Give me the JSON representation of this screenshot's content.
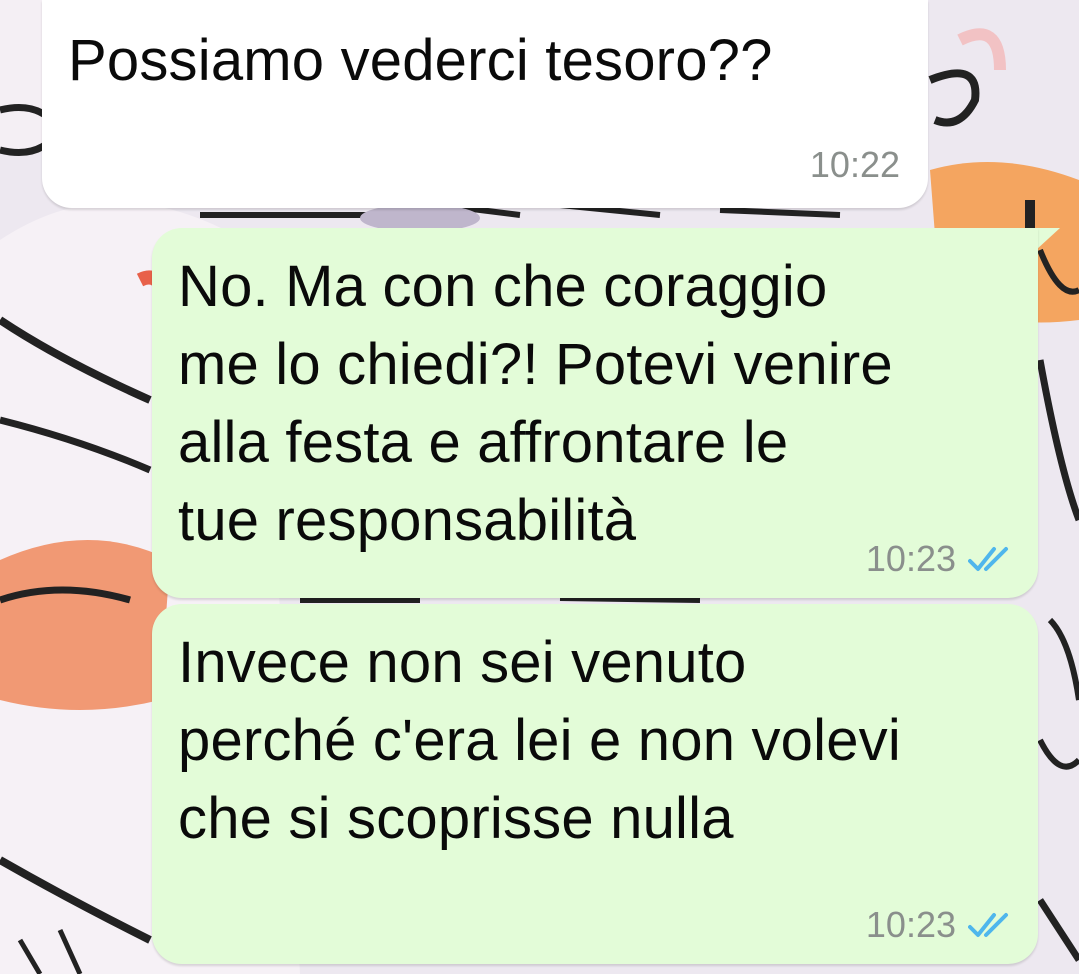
{
  "wallpaper": {
    "description_icon": "cartoon-doodle-wallpaper"
  },
  "messages": [
    {
      "direction": "incoming",
      "text": "Possiamo vederci tesoro??",
      "time": "10:22"
    },
    {
      "direction": "outgoing",
      "text": "No. Ma con che coraggio\nme lo chiedi?! Potevi venire\nalla festa e affrontare le\ntue responsabilità",
      "time": "10:23",
      "status_icon": "double-check-read-icon"
    },
    {
      "direction": "outgoing",
      "text": "Invece non sei venuto\nperché c'era lei e non volevi\nche si scoprisse nulla",
      "time": "10:23",
      "status_icon": "double-check-read-icon"
    }
  ],
  "colors": {
    "incoming_bubble": "#ffffff",
    "outgoing_bubble": "#e3fcd8",
    "read_ticks": "#4fb6ec",
    "timestamp": "#8a8f8c"
  }
}
